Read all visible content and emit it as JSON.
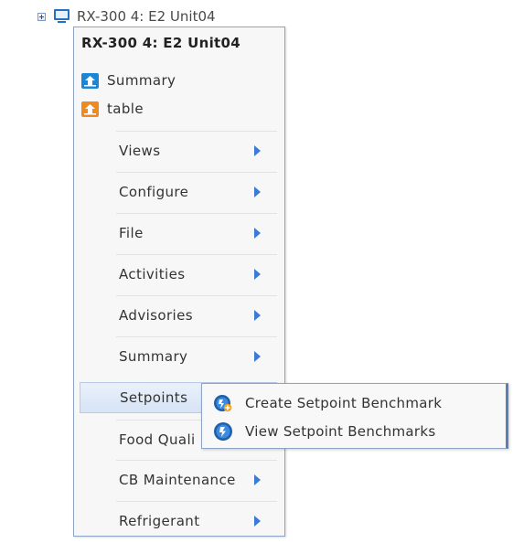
{
  "tree": {
    "node_label": "RX-300 4: E2 Unit04",
    "expander_icon": "plus-expander-icon",
    "device_icon": "monitor-device-icon"
  },
  "context_menu": {
    "title": "RX-300 4: E2 Unit04",
    "quick_items": [
      {
        "label": "Summary",
        "icon": "summary-icon",
        "color": "#1b86d6"
      },
      {
        "label": "table",
        "icon": "table-icon",
        "color": "#f08a1c"
      }
    ],
    "items": [
      {
        "label": "Views",
        "has_submenu": true
      },
      {
        "label": "Configure",
        "has_submenu": true
      },
      {
        "label": "File",
        "has_submenu": true
      },
      {
        "label": "Activities",
        "has_submenu": true
      },
      {
        "label": "Advisories",
        "has_submenu": true
      },
      {
        "label": "Summary",
        "has_submenu": true
      },
      {
        "label": "Setpoints",
        "has_submenu": true,
        "active": true
      },
      {
        "label": "Food Quali",
        "has_submenu": true
      },
      {
        "label": "CB Maintenance",
        "has_submenu": true
      },
      {
        "label": "Refrigerant",
        "has_submenu": true
      }
    ]
  },
  "submenu": {
    "parent": "Setpoints",
    "items": [
      {
        "label": "Create Setpoint Benchmark",
        "icon": "create-benchmark-icon"
      },
      {
        "label": "View Setpoint Benchmarks",
        "icon": "view-benchmark-icon"
      }
    ]
  },
  "colors": {
    "accent": "#3a7bd5",
    "menu_border": "#8ea4c5",
    "highlight": "#d6e4f6"
  }
}
